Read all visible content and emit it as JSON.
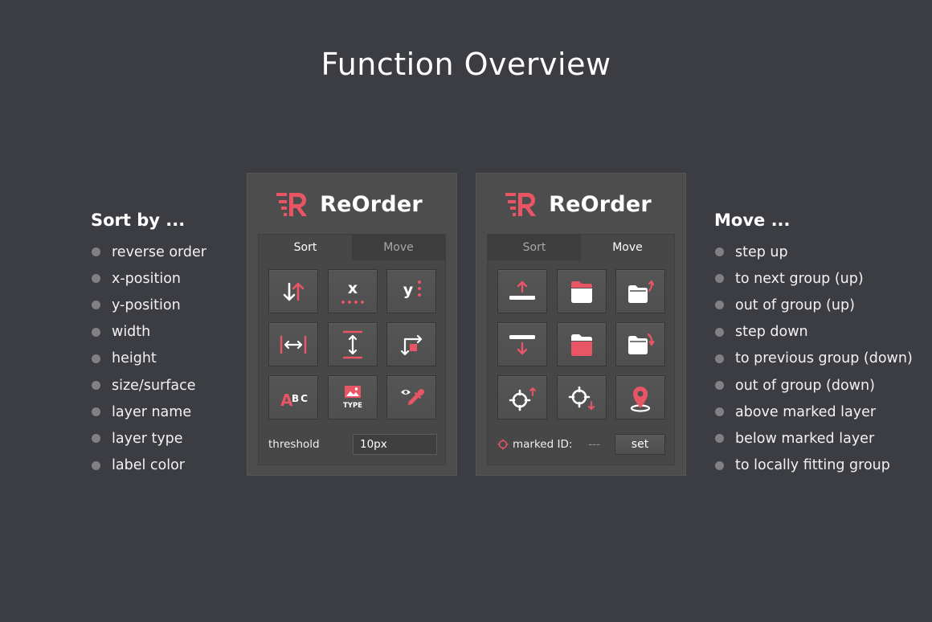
{
  "page": {
    "title": "Function Overview"
  },
  "colors": {
    "accent": "#e85565",
    "background": "#3c3d42",
    "panel": "#4d4d4d"
  },
  "sort_list": {
    "heading": "Sort by ...",
    "items": [
      "reverse order",
      "x-position",
      "y-position",
      "width",
      "height",
      "size/surface",
      "layer name",
      "layer type",
      "label color"
    ]
  },
  "move_list": {
    "heading": "Move ...",
    "items": [
      "step up",
      "to next group (up)",
      "out of group (up)",
      "step down",
      "to previous group (down)",
      "out of group (down)",
      "above marked layer",
      "below marked layer",
      "to locally fitting group"
    ]
  },
  "sort_panel": {
    "app_name": "ReOrder",
    "logo_icon": "reorder-logo-icon",
    "tabs": [
      {
        "label": "Sort",
        "active": true
      },
      {
        "label": "Move",
        "active": false
      }
    ],
    "buttons": [
      {
        "icon": "reverse-order-icon"
      },
      {
        "icon": "x-position-icon",
        "glyph": "x"
      },
      {
        "icon": "y-position-icon",
        "glyph": "y"
      },
      {
        "icon": "width-icon"
      },
      {
        "icon": "height-icon"
      },
      {
        "icon": "size-surface-icon"
      },
      {
        "icon": "layer-name-icon",
        "glyph": "A",
        "glyph2": "BC"
      },
      {
        "icon": "layer-type-icon",
        "glyph": "TYPE"
      },
      {
        "icon": "label-color-icon"
      }
    ],
    "threshold_label": "threshold",
    "threshold_value": "10px"
  },
  "move_panel": {
    "app_name": "ReOrder",
    "logo_icon": "reorder-logo-icon",
    "tabs": [
      {
        "label": "Sort",
        "active": false
      },
      {
        "label": "Move",
        "active": true
      }
    ],
    "buttons": [
      {
        "icon": "step-up-icon"
      },
      {
        "icon": "next-group-up-icon"
      },
      {
        "icon": "out-of-group-up-icon"
      },
      {
        "icon": "step-down-icon"
      },
      {
        "icon": "previous-group-down-icon"
      },
      {
        "icon": "out-of-group-down-icon"
      },
      {
        "icon": "above-marked-layer-icon"
      },
      {
        "icon": "below-marked-layer-icon"
      },
      {
        "icon": "locally-fitting-group-icon"
      }
    ],
    "marked_label": "marked ID:",
    "marked_value": "---",
    "set_label": "set"
  }
}
